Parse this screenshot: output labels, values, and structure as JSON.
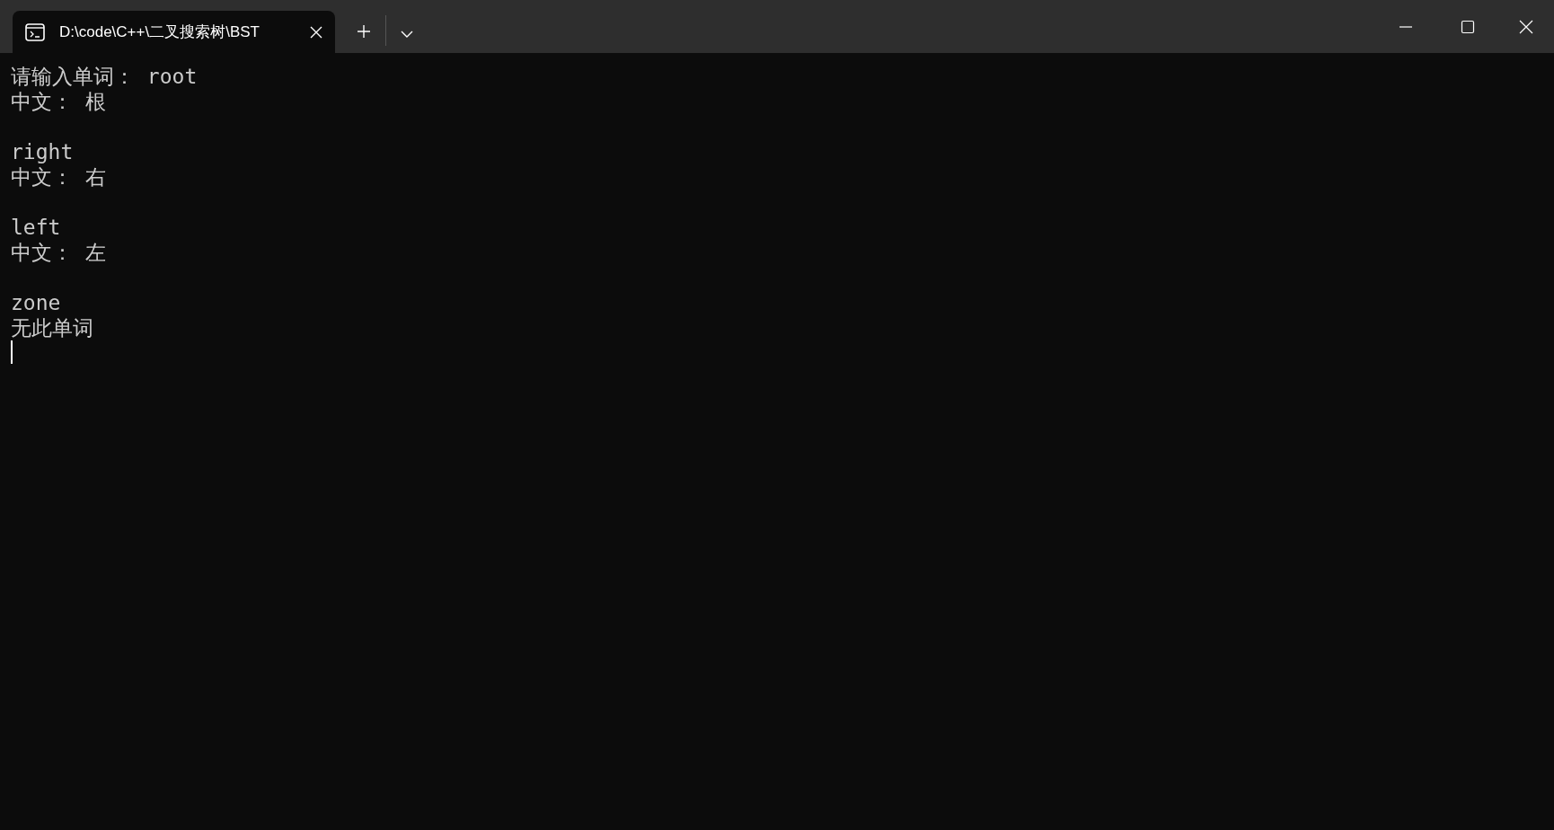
{
  "tabs": [
    {
      "title": "D:\\code\\C++\\二叉搜索树\\BST",
      "selected": true
    }
  ],
  "output": [
    {
      "lines": [
        "请输入单词： root",
        "中文： 根"
      ]
    },
    {
      "lines": [
        "right",
        "中文： 右"
      ]
    },
    {
      "lines": [
        "left",
        "中文： 左"
      ]
    },
    {
      "lines": [
        "zone",
        "无此单词"
      ]
    }
  ],
  "cursor": true
}
